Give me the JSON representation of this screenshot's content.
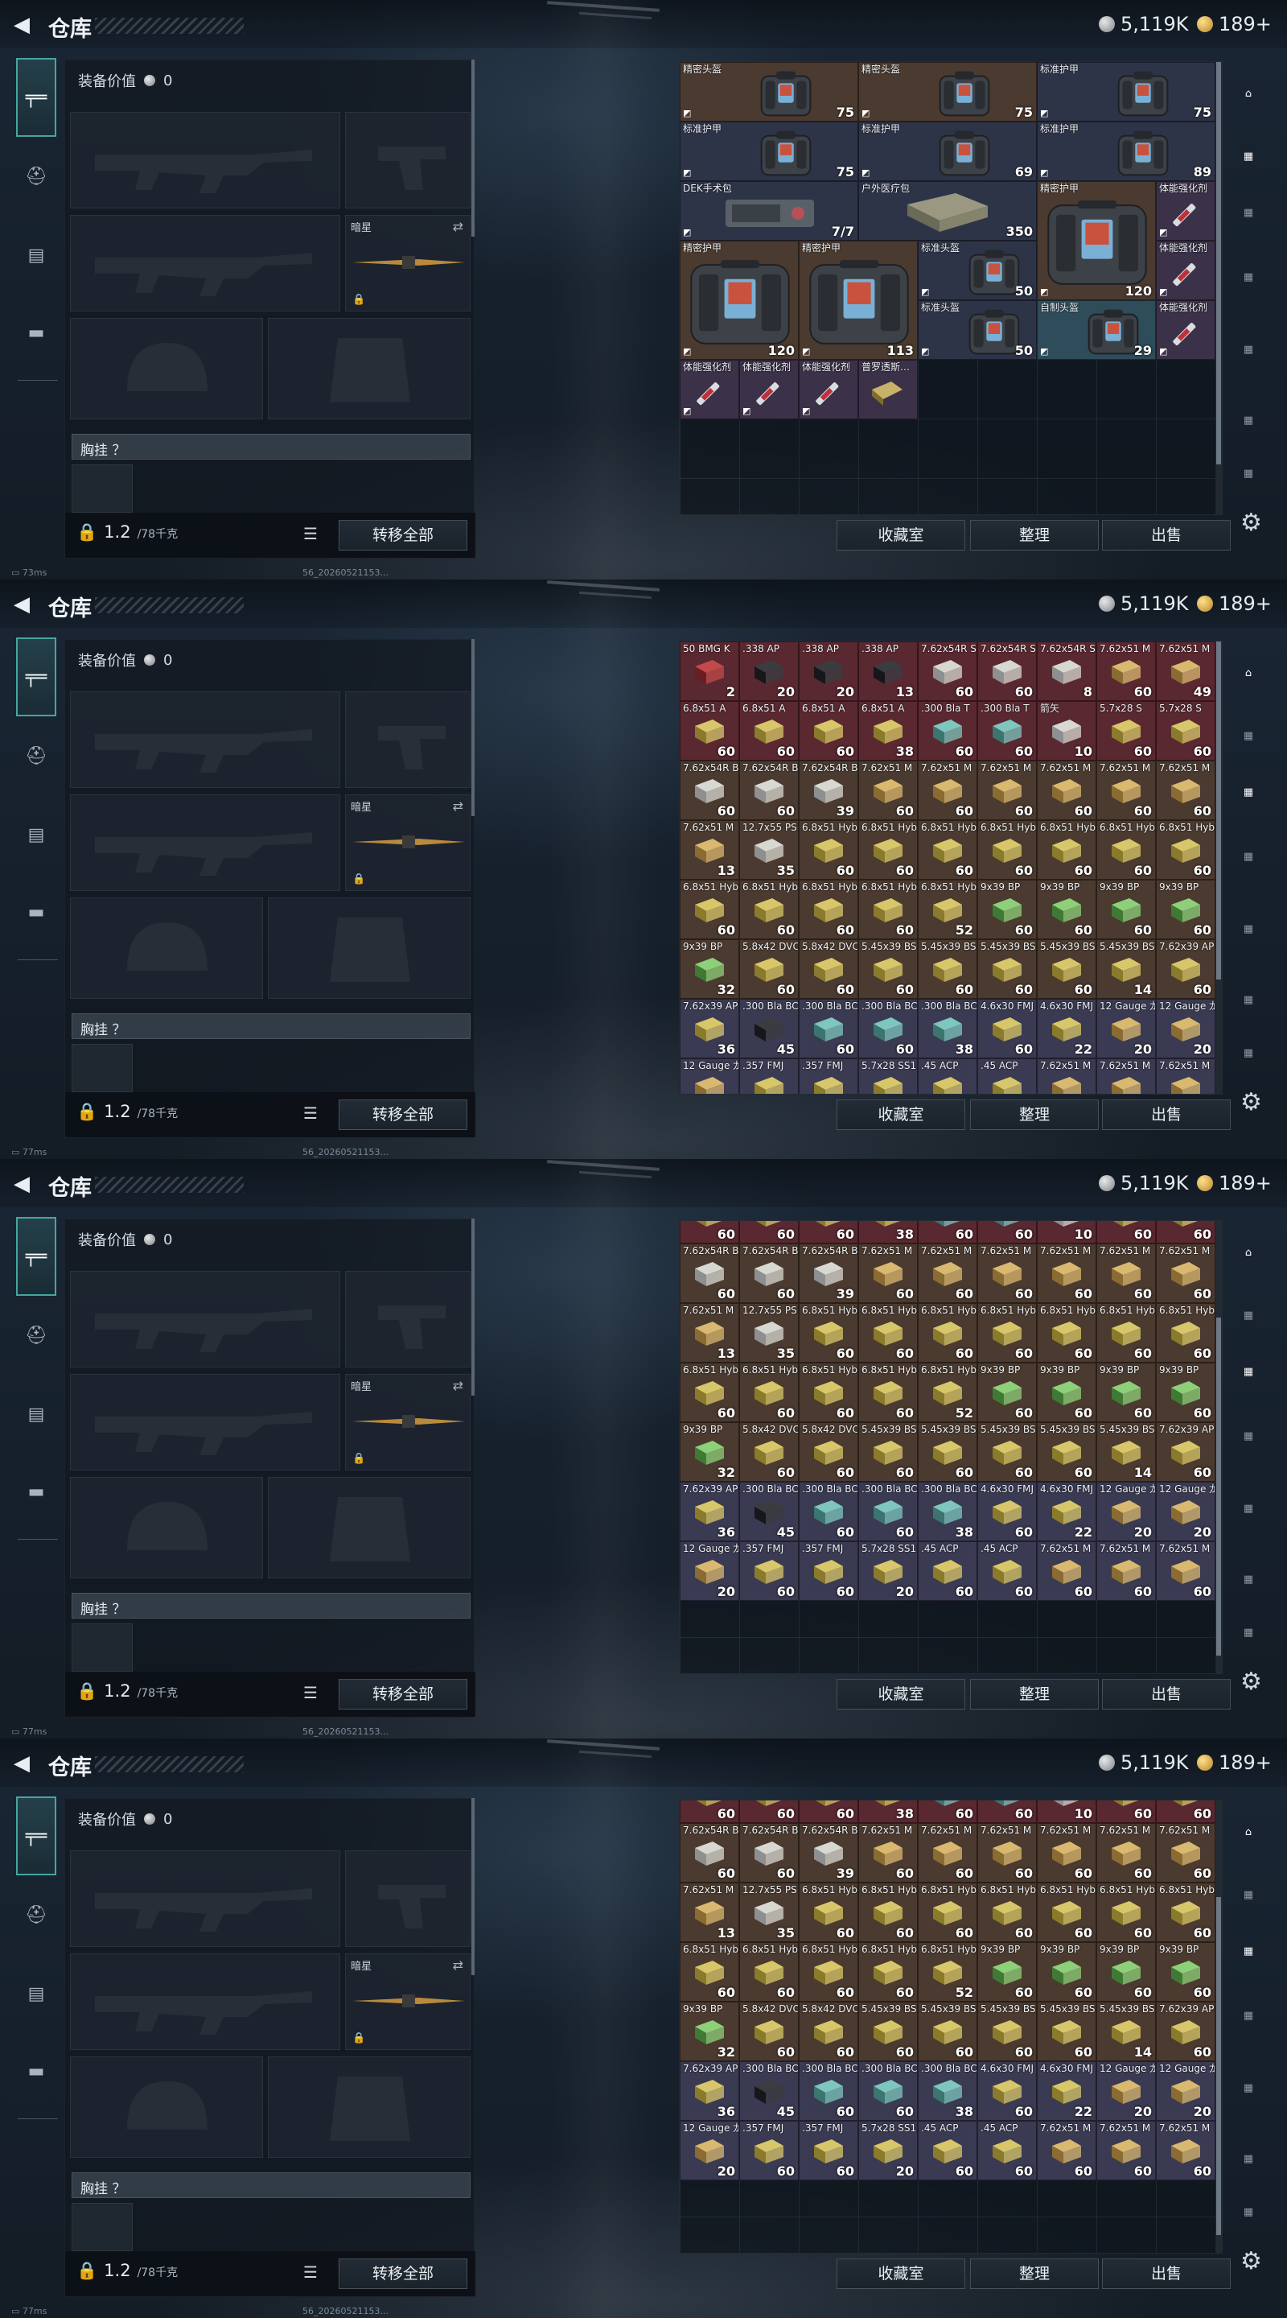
{
  "header": {
    "title": "仓库",
    "silver": "5,119K",
    "gold": "189+"
  },
  "equipment": {
    "value_label": "装备价值",
    "value": "0",
    "secondary_label": "暗星",
    "vest_label": "胸挂 ？",
    "weight": "1.2",
    "weight_max": "/78千克",
    "transfer_all": "转移全部"
  },
  "inventory": {
    "buttons": {
      "collection": "收藏室",
      "organize": "整理",
      "sell": "出售"
    }
  },
  "status": {
    "ping_1": "73ms",
    "ping_2": "77ms",
    "build": "56_20260521153..."
  },
  "gear_items": [
    {
      "name": "精密头盔",
      "count": "75",
      "col": 0,
      "row": 0,
      "w": 3,
      "h": 1,
      "kind": "bag",
      "bg": "#4b3a2f"
    },
    {
      "name": "精密头盔",
      "count": "75",
      "col": 3,
      "row": 0,
      "w": 3,
      "h": 1,
      "kind": "bag",
      "bg": "#4b3a2f"
    },
    {
      "name": "标准护甲",
      "count": "75",
      "col": 6,
      "row": 0,
      "w": 3,
      "h": 1,
      "kind": "bag",
      "bg": "#2e3448"
    },
    {
      "name": "标准护甲",
      "count": "75",
      "col": 0,
      "row": 1,
      "w": 3,
      "h": 1,
      "kind": "bag",
      "bg": "#2e3448"
    },
    {
      "name": "标准护甲",
      "count": "69",
      "col": 3,
      "row": 1,
      "w": 3,
      "h": 1,
      "kind": "bag",
      "bg": "#2e3448"
    },
    {
      "name": "标准护甲",
      "count": "89",
      "col": 6,
      "row": 1,
      "w": 3,
      "h": 1,
      "kind": "bag",
      "bg": "#2e3448"
    },
    {
      "name": "DEK手术包",
      "count": "7/7",
      "col": 0,
      "row": 2,
      "w": 3,
      "h": 1,
      "kind": "kit",
      "bg": "#2e3448"
    },
    {
      "name": "户外医疗包",
      "count": "350",
      "col": 3,
      "row": 2,
      "w": 3,
      "h": 1,
      "kind": "med",
      "bg": "#2e3448"
    },
    {
      "name": "精密护甲",
      "count": "120",
      "col": 6,
      "row": 2,
      "w": 2,
      "h": 2,
      "kind": "bag",
      "bg": "#4b3a2f"
    },
    {
      "name": "体能强化剂",
      "count": "",
      "col": 8,
      "row": 2,
      "w": 1,
      "h": 1,
      "kind": "syr",
      "bg": "#3b3148"
    },
    {
      "name": "精密护甲",
      "count": "120",
      "col": 0,
      "row": 3,
      "w": 2,
      "h": 2,
      "kind": "bag",
      "bg": "#4b3a2f"
    },
    {
      "name": "精密护甲",
      "count": "113",
      "col": 2,
      "row": 3,
      "w": 2,
      "h": 2,
      "kind": "bag",
      "bg": "#4b3a2f"
    },
    {
      "name": "标准头盔",
      "count": "50",
      "col": 4,
      "row": 3,
      "w": 2,
      "h": 1,
      "kind": "bag",
      "bg": "#2e3448"
    },
    {
      "name": "体能强化剂",
      "count": "",
      "col": 8,
      "row": 3,
      "w": 1,
      "h": 1,
      "kind": "syr",
      "bg": "#3b3148"
    },
    {
      "name": "标准头盔",
      "count": "50",
      "col": 4,
      "row": 4,
      "w": 2,
      "h": 1,
      "kind": "bag",
      "bg": "#2e3448"
    },
    {
      "name": "自制头盔",
      "count": "29",
      "col": 6,
      "row": 4,
      "w": 2,
      "h": 1,
      "kind": "bag",
      "bg": "#2e4c5a"
    },
    {
      "name": "体能强化剂",
      "count": "",
      "col": 8,
      "row": 4,
      "w": 1,
      "h": 1,
      "kind": "syr",
      "bg": "#3b3148"
    },
    {
      "name": "体能强化剂",
      "count": "",
      "col": 0,
      "row": 5,
      "w": 1,
      "h": 1,
      "kind": "syr",
      "bg": "#3b3148"
    },
    {
      "name": "体能强化剂",
      "count": "",
      "col": 1,
      "row": 5,
      "w": 1,
      "h": 1,
      "kind": "syr",
      "bg": "#3b3148"
    },
    {
      "name": "体能强化剂",
      "count": "",
      "col": 2,
      "row": 5,
      "w": 1,
      "h": 1,
      "kind": "syr",
      "bg": "#3b3148"
    },
    {
      "name": "普罗透斯…",
      "count": "",
      "col": 3,
      "row": 5,
      "w": 1,
      "h": 1,
      "kind": "pack",
      "bg": "#3b3148"
    }
  ],
  "ammo_top": [
    {
      "name": "50 BMG K",
      "count": "2",
      "bg": "#5a2830",
      "kind": "red"
    },
    {
      "name": ".338 AP",
      "count": "20",
      "bg": "#5a2830",
      "kind": "dark"
    },
    {
      "name": ".338 AP",
      "count": "20",
      "bg": "#5a2830",
      "kind": "dark"
    },
    {
      "name": ".338 AP",
      "count": "13",
      "bg": "#5a2830",
      "kind": "dark"
    },
    {
      "name": "7.62x54R S",
      "count": "60",
      "bg": "#5a2830",
      "kind": "white"
    },
    {
      "name": "7.62x54R S",
      "count": "60",
      "bg": "#5a2830",
      "kind": "white"
    },
    {
      "name": "7.62x54R S",
      "count": "8",
      "bg": "#5a2830",
      "kind": "white"
    },
    {
      "name": "7.62x51 M",
      "count": "60",
      "bg": "#5a2830",
      "kind": "tan"
    },
    {
      "name": "7.62x51 M",
      "count": "49",
      "bg": "#5a2830",
      "kind": "tan"
    },
    {
      "name": "6.8x51 A",
      "count": "60",
      "bg": "#5a2830",
      "kind": "ylw"
    },
    {
      "name": "6.8x51 A",
      "count": "60",
      "bg": "#5a2830",
      "kind": "ylw"
    },
    {
      "name": "6.8x51 A",
      "count": "60",
      "bg": "#5a2830",
      "kind": "ylw"
    },
    {
      "name": "6.8x51 A",
      "count": "38",
      "bg": "#5a2830",
      "kind": "ylw"
    },
    {
      "name": ".300 Bla T",
      "count": "60",
      "bg": "#5a2830",
      "kind": "teal"
    },
    {
      "name": ".300 Bla T",
      "count": "60",
      "bg": "#5a2830",
      "kind": "teal"
    },
    {
      "name": "箭矢",
      "count": "10",
      "bg": "#5a2830",
      "kind": "white"
    },
    {
      "name": "5.7x28 S",
      "count": "60",
      "bg": "#5a2830",
      "kind": "ylw"
    },
    {
      "name": "5.7x28 S",
      "count": "60",
      "bg": "#5a2830",
      "kind": "ylw"
    }
  ],
  "ammo_rows": [
    [
      {
        "name": "7.62x54R B",
        "count": "60",
        "bg": "#4b3a2f",
        "kind": "white"
      },
      {
        "name": "7.62x54R B",
        "count": "60",
        "bg": "#4b3a2f",
        "kind": "white"
      },
      {
        "name": "7.62x54R B",
        "count": "39",
        "bg": "#4b3a2f",
        "kind": "white"
      },
      {
        "name": "7.62x51 M",
        "count": "60",
        "bg": "#4b3a2f",
        "kind": "tan"
      },
      {
        "name": "7.62x51 M",
        "count": "60",
        "bg": "#4b3a2f",
        "kind": "tan"
      },
      {
        "name": "7.62x51 M",
        "count": "60",
        "bg": "#4b3a2f",
        "kind": "tan"
      },
      {
        "name": "7.62x51 M",
        "count": "60",
        "bg": "#4b3a2f",
        "kind": "tan"
      },
      {
        "name": "7.62x51 M",
        "count": "60",
        "bg": "#4b3a2f",
        "kind": "tan"
      },
      {
        "name": "7.62x51 M",
        "count": "60",
        "bg": "#4b3a2f",
        "kind": "tan"
      }
    ],
    [
      {
        "name": "7.62x51 M",
        "count": "13",
        "bg": "#4b3a2f",
        "kind": "tan"
      },
      {
        "name": "12.7x55 PS12",
        "count": "35",
        "bg": "#4b3a2f",
        "kind": "white"
      },
      {
        "name": "6.8x51 Hybrid",
        "count": "60",
        "bg": "#4b3a2f",
        "kind": "ylw"
      },
      {
        "name": "6.8x51 Hybrid",
        "count": "60",
        "bg": "#4b3a2f",
        "kind": "ylw"
      },
      {
        "name": "6.8x51 Hybrid",
        "count": "60",
        "bg": "#4b3a2f",
        "kind": "ylw"
      },
      {
        "name": "6.8x51 Hybrid",
        "count": "60",
        "bg": "#4b3a2f",
        "kind": "ylw"
      },
      {
        "name": "6.8x51 Hybrid",
        "count": "60",
        "bg": "#4b3a2f",
        "kind": "ylw"
      },
      {
        "name": "6.8x51 Hybrid",
        "count": "60",
        "bg": "#4b3a2f",
        "kind": "ylw"
      },
      {
        "name": "6.8x51 Hybrid",
        "count": "60",
        "bg": "#4b3a2f",
        "kind": "ylw"
      }
    ],
    [
      {
        "name": "6.8x51 Hybrid",
        "count": "60",
        "bg": "#4b3a2f",
        "kind": "ylw"
      },
      {
        "name": "6.8x51 Hybrid",
        "count": "60",
        "bg": "#4b3a2f",
        "kind": "ylw"
      },
      {
        "name": "6.8x51 Hybrid",
        "count": "60",
        "bg": "#4b3a2f",
        "kind": "ylw"
      },
      {
        "name": "6.8x51 Hybrid",
        "count": "60",
        "bg": "#4b3a2f",
        "kind": "ylw"
      },
      {
        "name": "6.8x51 Hybrid",
        "count": "52",
        "bg": "#4b3a2f",
        "kind": "ylw"
      },
      {
        "name": "9x39 BP",
        "count": "60",
        "bg": "#4b3a2f",
        "kind": "green"
      },
      {
        "name": "9x39 BP",
        "count": "60",
        "bg": "#4b3a2f",
        "kind": "green"
      },
      {
        "name": "9x39 BP",
        "count": "60",
        "bg": "#4b3a2f",
        "kind": "green"
      },
      {
        "name": "9x39 BP",
        "count": "60",
        "bg": "#4b3a2f",
        "kind": "green"
      }
    ],
    [
      {
        "name": "9x39 BP",
        "count": "32",
        "bg": "#4b3a2f",
        "kind": "green"
      },
      {
        "name": "5.8x42 DVC12",
        "count": "60",
        "bg": "#4b3a2f",
        "kind": "ylw"
      },
      {
        "name": "5.8x42 DVC12",
        "count": "60",
        "bg": "#4b3a2f",
        "kind": "ylw"
      },
      {
        "name": "5.45x39 BS",
        "count": "60",
        "bg": "#4b3a2f",
        "kind": "ylw"
      },
      {
        "name": "5.45x39 BS",
        "count": "60",
        "bg": "#4b3a2f",
        "kind": "ylw"
      },
      {
        "name": "5.45x39 BS",
        "count": "60",
        "bg": "#4b3a2f",
        "kind": "ylw"
      },
      {
        "name": "5.45x39 BS",
        "count": "60",
        "bg": "#4b3a2f",
        "kind": "ylw"
      },
      {
        "name": "5.45x39 BS",
        "count": "14",
        "bg": "#4b3a2f",
        "kind": "ylw"
      },
      {
        "name": "7.62x39 AP",
        "count": "60",
        "bg": "#4b3a2f",
        "kind": "ylw"
      }
    ],
    [
      {
        "name": "7.62x39 AP",
        "count": "36",
        "bg": "#3a3a52",
        "kind": "ylw"
      },
      {
        "name": ".300 Bla BCP SB",
        "count": "45",
        "bg": "#3a3a52",
        "kind": "dark"
      },
      {
        "name": ".300 Bla BCP FMJ",
        "count": "60",
        "bg": "#3a3a52",
        "kind": "teal"
      },
      {
        "name": ".300 Bla BCP FMJ",
        "count": "60",
        "bg": "#3a3a52",
        "kind": "teal"
      },
      {
        "name": ".300 Bla BCP FMJ",
        "count": "38",
        "bg": "#3a3a52",
        "kind": "teal"
      },
      {
        "name": "4.6x30 FMJ SX",
        "count": "60",
        "bg": "#3a3a52",
        "kind": "ylw"
      },
      {
        "name": "4.6x30 FMJ SX",
        "count": "22",
        "bg": "#3a3a52",
        "kind": "ylw"
      },
      {
        "name": "12 Gauge 龙息弹",
        "count": "20",
        "bg": "#3a3a52",
        "kind": "tan"
      },
      {
        "name": "12 Gauge 龙息弹",
        "count": "20",
        "bg": "#3a3a52",
        "kind": "tan"
      }
    ],
    [
      {
        "name": "12 Gauge 龙息弹",
        "count": "20",
        "bg": "#3a3a52",
        "kind": "tan"
      },
      {
        "name": ".357 FMJ",
        "count": "60",
        "bg": "#3a3a52",
        "kind": "ylw"
      },
      {
        "name": ".357 FMJ",
        "count": "60",
        "bg": "#3a3a52",
        "kind": "ylw"
      },
      {
        "name": "5.7x28 SS190",
        "count": "20",
        "bg": "#3a3a52",
        "kind": "ylw"
      },
      {
        "name": ".45 ACP",
        "count": "60",
        "bg": "#3a3a52",
        "kind": "ylw"
      },
      {
        "name": ".45 ACP",
        "count": "60",
        "bg": "#3a3a52",
        "kind": "ylw"
      },
      {
        "name": "7.62x51 M",
        "count": "60",
        "bg": "#3a3a52",
        "kind": "tan"
      },
      {
        "name": "7.62x51 M",
        "count": "60",
        "bg": "#3a3a52",
        "kind": "tan"
      },
      {
        "name": "7.62x51 M",
        "count": "60",
        "bg": "#3a3a52",
        "kind": "tan"
      }
    ]
  ],
  "ammo_peek": [
    {
      "count": "60",
      "bg": "#5a2830",
      "kind": "ylw"
    },
    {
      "count": "60",
      "bg": "#5a2830",
      "kind": "ylw"
    },
    {
      "count": "60",
      "bg": "#5a2830",
      "kind": "ylw"
    },
    {
      "count": "38",
      "bg": "#5a2830",
      "kind": "ylw"
    },
    {
      "count": "60",
      "bg": "#5a2830",
      "kind": "teal"
    },
    {
      "count": "60",
      "bg": "#5a2830",
      "kind": "teal"
    },
    {
      "count": "10",
      "bg": "#5a2830",
      "kind": "white"
    },
    {
      "count": "60",
      "bg": "#5a2830",
      "kind": "ylw"
    },
    {
      "count": "60",
      "bg": "#5a2830",
      "kind": "ylw"
    }
  ],
  "colors": {
    "accent": "#46a6a0",
    "rarity_red": "#5a2830",
    "rarity_gold": "#4b3a2f",
    "rarity_purple": "#3a3a52"
  },
  "icons": [
    "back-arrow-icon",
    "silver-coin-icon",
    "gold-coin-icon",
    "rifle-icon",
    "helmet-icon",
    "vest-icon",
    "case-icon",
    "lock-icon",
    "swap-icon",
    "list-icon",
    "settings-icon"
  ]
}
